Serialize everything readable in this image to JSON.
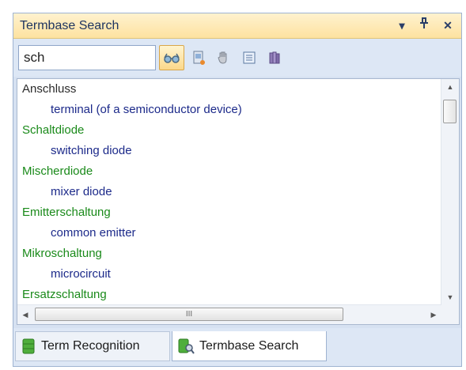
{
  "panel": {
    "title": "Termbase Search",
    "title_buttons": {
      "dropdown": "▾",
      "pin": "⊕",
      "close": "✕"
    }
  },
  "search": {
    "value": "sch",
    "placeholder": ""
  },
  "toolbar": {
    "buttons": [
      {
        "name": "search-settings",
        "icon": "eye-glasses-icon",
        "active": true
      },
      {
        "name": "new-entry",
        "icon": "document-icon",
        "active": false
      },
      {
        "name": "edit-entry",
        "icon": "hand-icon",
        "active": false
      },
      {
        "name": "view-entry",
        "icon": "list-icon",
        "active": false
      },
      {
        "name": "termbase",
        "icon": "database-icon",
        "active": false
      }
    ]
  },
  "results": [
    {
      "type": "source",
      "text": "Anschluss",
      "color": "#2a2a2a"
    },
    {
      "type": "target",
      "text": "terminal (of a semiconductor device)"
    },
    {
      "type": "source",
      "text": "Schaltdiode",
      "color": "#1a8a1a"
    },
    {
      "type": "target",
      "text": "switching diode"
    },
    {
      "type": "source",
      "text": "Mischerdiode",
      "color": "#1a8a1a"
    },
    {
      "type": "target",
      "text": "mixer diode"
    },
    {
      "type": "source",
      "text": "Emitterschaltung",
      "color": "#1a8a1a"
    },
    {
      "type": "target",
      "text": "common emitter"
    },
    {
      "type": "source",
      "text": "Mikroschaltung",
      "color": "#1a8a1a"
    },
    {
      "type": "target",
      "text": "microcircuit"
    },
    {
      "type": "source",
      "text": "Ersatzschaltung",
      "color": "#1a8a1a"
    }
  ],
  "hscroll_grip": "III",
  "tabs": [
    {
      "label": "Term Recognition",
      "icon": "termbase-icon",
      "active": false
    },
    {
      "label": "Termbase Search",
      "icon": "termbase-search-icon",
      "active": true
    }
  ]
}
